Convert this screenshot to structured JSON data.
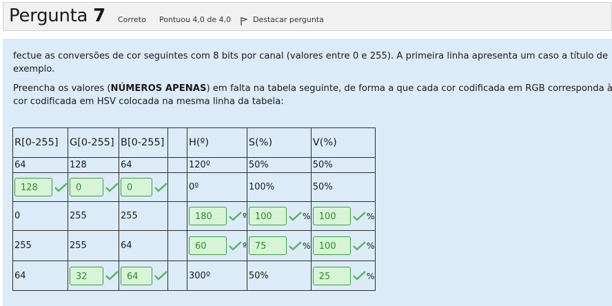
{
  "header": {
    "title_word": "Pergunta",
    "title_number": "7",
    "status": "Correto",
    "score": "Pontuou 4,0 de 4,0",
    "flag_label": "Destacar pergunta"
  },
  "question": {
    "para1": "fectue as conversões de cor seguintes com 8 bits por canal (valores entre 0 e 255). A primeira linha apresenta um caso a título de exemplo.",
    "para2_pre": "Preencha os valores (",
    "para2_bold": "NÚMEROS APENAS",
    "para2_post": ") em falta na tabela seguinte, de forma a que cada cor codificada em RGB corresponda à cor codificada em HSV colocada na mesma linha da tabela:"
  },
  "table": {
    "headers": [
      "R[0-255]",
      "G[0-255]",
      "B[0-255]",
      "",
      "H(º)",
      "S(%)",
      "V(%)"
    ],
    "rows": [
      [
        {
          "text": "64"
        },
        {
          "text": "128"
        },
        {
          "text": "64"
        },
        {
          "text": ""
        },
        {
          "text": "120º"
        },
        {
          "text": "50%"
        },
        {
          "text": "50%"
        }
      ],
      [
        {
          "input": "128"
        },
        {
          "input": "0"
        },
        {
          "input": "0"
        },
        {
          "text": ""
        },
        {
          "text": "0º"
        },
        {
          "text": "100%"
        },
        {
          "text": "50%"
        }
      ],
      [
        {
          "text": "0"
        },
        {
          "text": "255"
        },
        {
          "text": "255"
        },
        {
          "text": ""
        },
        {
          "input": "180",
          "unit": "º"
        },
        {
          "input": "100",
          "unit": "%"
        },
        {
          "input": "100",
          "unit": "%"
        }
      ],
      [
        {
          "text": "255"
        },
        {
          "text": "255"
        },
        {
          "text": "64"
        },
        {
          "text": ""
        },
        {
          "input": "60",
          "unit": "º"
        },
        {
          "input": "75",
          "unit": "%"
        },
        {
          "input": "100",
          "unit": "%"
        }
      ],
      [
        {
          "text": "64"
        },
        {
          "input": "32"
        },
        {
          "input": "64"
        },
        {
          "text": ""
        },
        {
          "text": "300º"
        },
        {
          "text": "50%"
        },
        {
          "input": "25",
          "unit": "%"
        }
      ]
    ]
  },
  "colors": {
    "correct_green": "#5cb85c",
    "input_bg": "#d7f5d6",
    "content_bg": "#dbecf8"
  }
}
